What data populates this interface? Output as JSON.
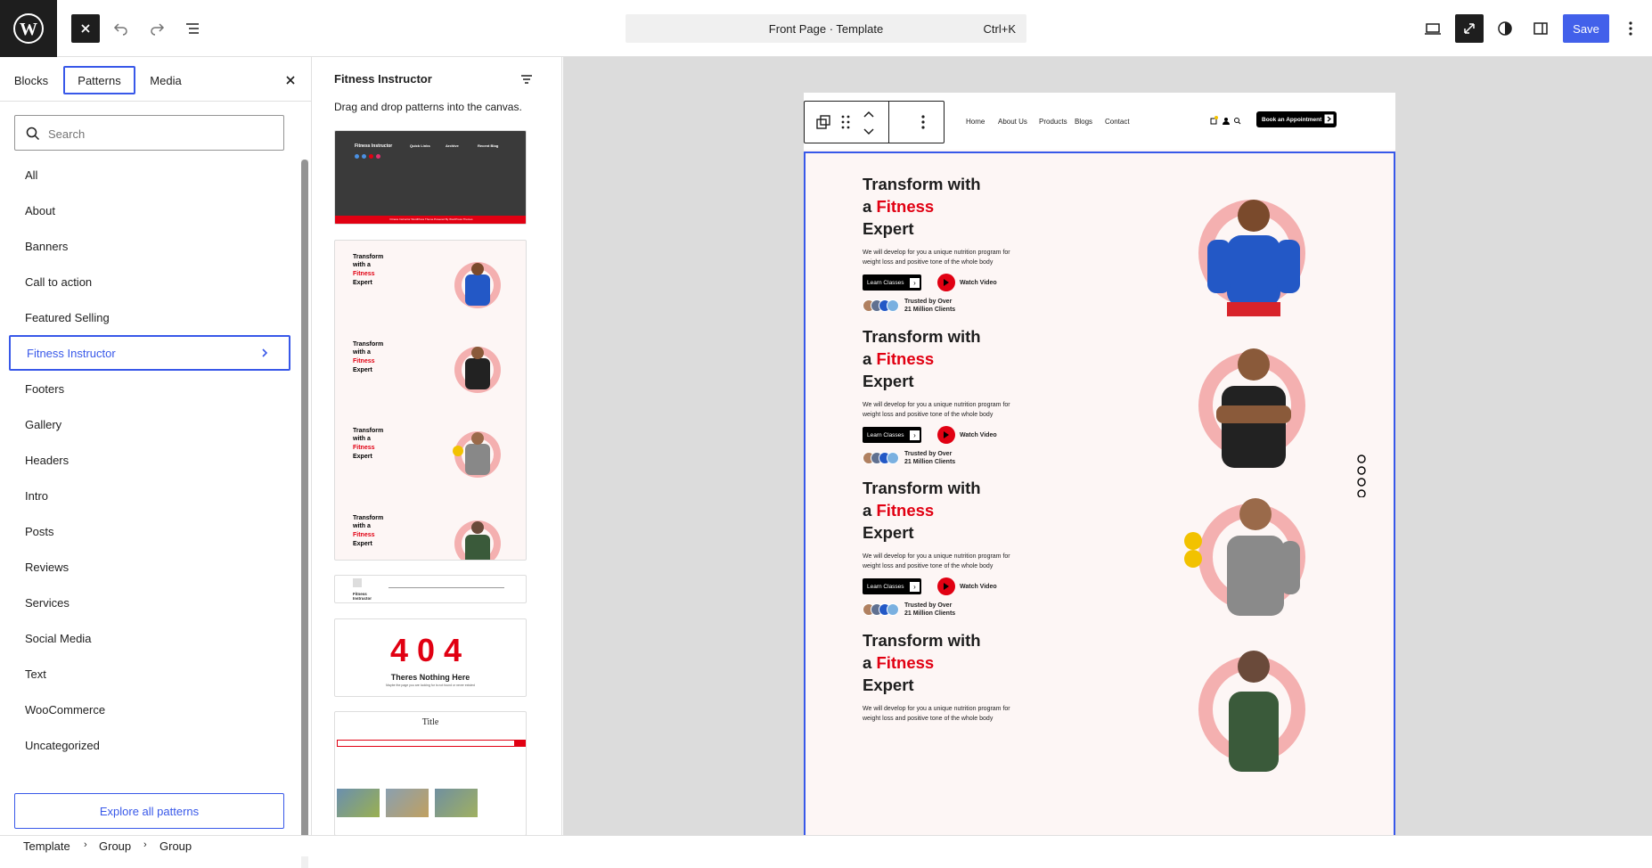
{
  "topbar": {
    "command": "Front Page · Template",
    "shortcut": "Ctrl+K",
    "save": "Save"
  },
  "inserter": {
    "tabs": [
      "Blocks",
      "Patterns",
      "Media"
    ],
    "search_placeholder": "Search",
    "categories": [
      "All",
      "About",
      "Banners",
      "Call to action",
      "Featured Selling",
      "Fitness Instructor",
      "Footers",
      "Gallery",
      "Headers",
      "Intro",
      "Posts",
      "Reviews",
      "Services",
      "Social Media",
      "Text",
      "WooCommerce",
      "Uncategorized"
    ],
    "active_category": "Fitness Instructor",
    "explore": "Explore all patterns"
  },
  "patterns": {
    "title": "Fitness Instructor",
    "desc": "Drag and drop patterns into the canvas.",
    "p404_code": "404",
    "p404_title": "Theres Nothing Here",
    "p404_sub": "Maybe the page you are looking for is not found or never existed",
    "posts_title": "Title",
    "header_logo": "Fitness Instructor",
    "footer_logo": "Fitness Instructor",
    "footer_quick": "Quick Links",
    "footer_archive": "Archive",
    "footer_recent": "Recent Blog",
    "footer_bar": "Fitness Instructor WordPress Theme Powered By WordPress Themes"
  },
  "site": {
    "nav": [
      "Home",
      "About Us",
      "Products",
      "Blogs",
      "Contact"
    ],
    "book": "Book an Appointment",
    "hero_line1": "Transform with",
    "hero_a": "a ",
    "hero_fitness": "Fitness",
    "hero_line3": "Expert",
    "hero_desc": "We will develop for you a unique nutrition program for weight loss and positive tone of the whole body",
    "learn": "Learn Classes",
    "watch": "Watch Video",
    "trusted": "Trusted by Over 21 Million Clients"
  },
  "breadcrumb": [
    "Template",
    "Group",
    "Group"
  ],
  "colors": {
    "accent": "#3858e9",
    "brand_red": "#e10012",
    "dark": "#1e1e1e"
  }
}
